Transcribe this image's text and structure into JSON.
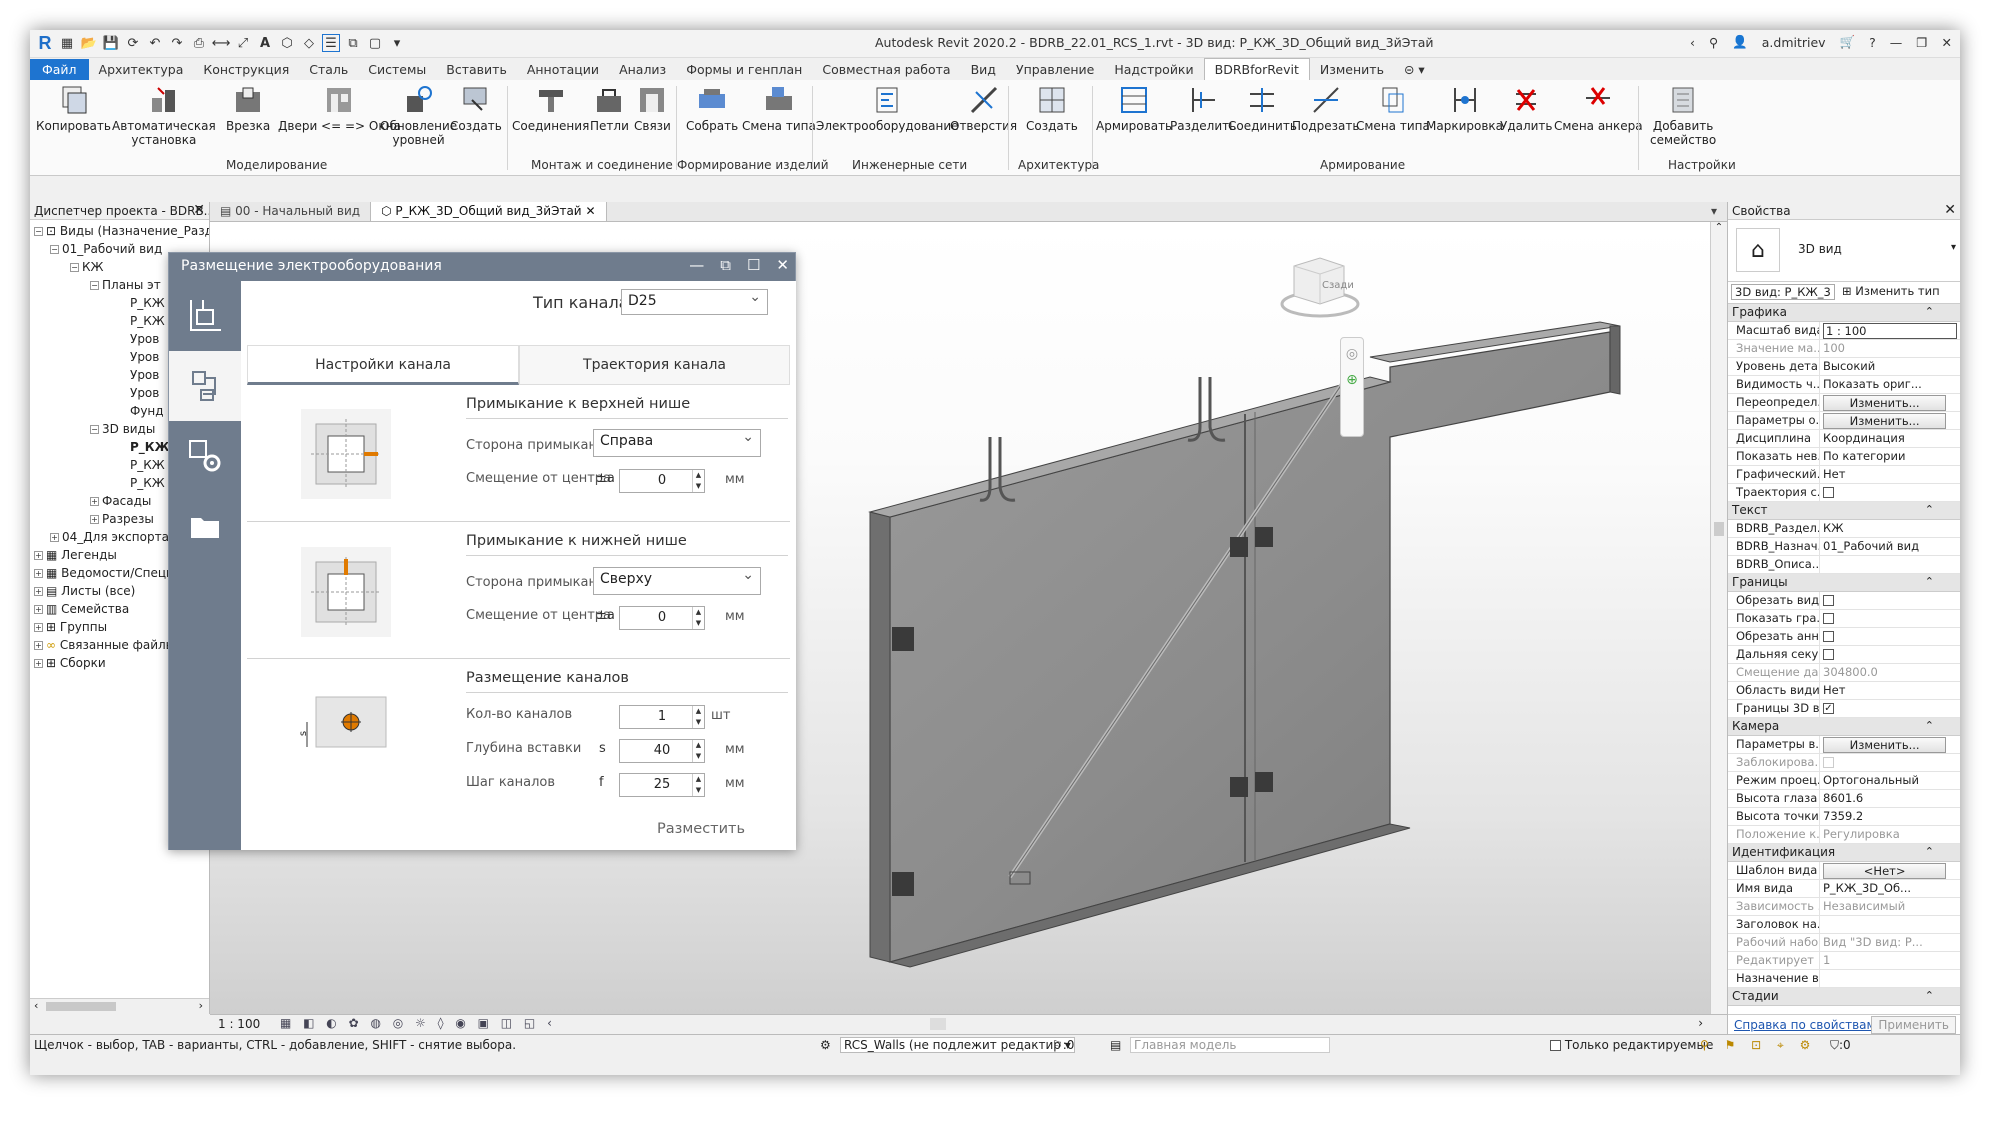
{
  "app": {
    "title": "Autodesk Revit 2020.2 - BDRB_22.01_RCS_1.rvt - 3D вид: Р_КЖ_3D_Общий вид_3йЭтай",
    "user": "a.dmitriev"
  },
  "ribbon_tabs": [
    "Файл",
    "Архитектура",
    "Конструкция",
    "Сталь",
    "Системы",
    "Вставить",
    "Аннотации",
    "Анализ",
    "Формы и генплан",
    "Совместная работа",
    "Вид",
    "Управление",
    "Надстройки",
    "BDRBforRevit",
    "Изменить"
  ],
  "ribbon": {
    "buttons": [
      {
        "label": "Копировать"
      },
      {
        "label": "Автоматическая\nустановка"
      },
      {
        "label": "Врезка"
      },
      {
        "label": "Двери <= => Окна"
      },
      {
        "label": "Обновление\nуровней"
      },
      {
        "label": "Создать"
      },
      {
        "label": "Соединения"
      },
      {
        "label": "Петли"
      },
      {
        "label": "Связи"
      },
      {
        "label": "Собрать"
      },
      {
        "label": "Смена типа"
      },
      {
        "label": "Электрооборудование"
      },
      {
        "label": "Отверстия"
      },
      {
        "label": "Создать"
      },
      {
        "label": "Армировать"
      },
      {
        "label": "Разделить"
      },
      {
        "label": "Соединить"
      },
      {
        "label": "Подрезать"
      },
      {
        "label": "Смена типа"
      },
      {
        "label": "Маркировка"
      },
      {
        "label": "Удалить"
      },
      {
        "label": "Смена анкера"
      },
      {
        "label": "Добавить\nсемейство"
      }
    ],
    "panels": [
      "Моделирование",
      "Монтаж и соединение",
      "Формирование изделий",
      "Инженерные сети",
      "Архитектура",
      "Армирование",
      "Настройки"
    ]
  },
  "browser": {
    "title": "Диспетчер проекта - BDRB...",
    "items": [
      {
        "text": "Виды (Назначение_Разд"
      },
      {
        "text": "01_Рабочий вид"
      },
      {
        "text": "КЖ"
      },
      {
        "text": "Планы эт"
      },
      {
        "text": "Р_КЖ"
      },
      {
        "text": "Р_КЖ"
      },
      {
        "text": "Уров"
      },
      {
        "text": "Уров"
      },
      {
        "text": "Уров"
      },
      {
        "text": "Уров"
      },
      {
        "text": "Фунд"
      },
      {
        "text": "3D виды"
      },
      {
        "text": "Р_КЖ"
      },
      {
        "text": "Р_КЖ"
      },
      {
        "text": "Р_КЖ"
      },
      {
        "text": "Фасады"
      },
      {
        "text": "Разрезы"
      },
      {
        "text": "04_Для экспорта"
      },
      {
        "text": "Легенды"
      },
      {
        "text": "Ведомости/Специ"
      },
      {
        "text": "Листы (все)"
      },
      {
        "text": "Семейства"
      },
      {
        "text": "Группы"
      },
      {
        "text": "Связанные файлы"
      },
      {
        "text": "Сборки"
      }
    ]
  },
  "view_tabs": [
    "00 - Начальный вид",
    "Р_КЖ_3D_Общий вид_3йЭтай"
  ],
  "viewbar": {
    "scale": "1 : 100"
  },
  "dialog": {
    "title": "Размещение электрооборудования",
    "channel_type_label": "Тип канала:",
    "channel_type_value": "D25",
    "tabs": [
      "Настройки канала",
      "Траектория канала"
    ],
    "top": {
      "header": "Примыкание к верхней нише",
      "side_label": "Сторона примыкания",
      "side_value": "Справа",
      "offset_label": "Смещение от центра",
      "offset_symbol": "±a",
      "offset_value": "0",
      "unit": "мм"
    },
    "bottom": {
      "header": "Примыкание к нижней нише",
      "side_label": "Сторона примыкания",
      "side_value": "Сверху",
      "offset_label": "Смещение от центра",
      "offset_symbol": "±a",
      "offset_value": "0",
      "unit": "мм"
    },
    "placement": {
      "header": "Размещение каналов",
      "count_label": "Кол-во каналов",
      "count_value": "1",
      "count_unit": "шт",
      "depth_label": "Глубина вставки",
      "depth_symbol": "s",
      "depth_value": "40",
      "depth_unit": "мм",
      "step_label": "Шаг каналов",
      "step_symbol": "f",
      "step_value": "25",
      "step_unit": "мм",
      "s_marker": "s"
    },
    "place_button": "Разместить"
  },
  "properties": {
    "title": "Свойства",
    "type_name": "3D вид",
    "selector": "3D вид: Р_КЖ_3",
    "edit_type": "Изменить тип",
    "groups": [
      {
        "name": "Графика",
        "rows": [
          {
            "k": "Масштаб вида",
            "v": "1 : 100",
            "kind": "input"
          },
          {
            "k": "Значение ма...",
            "v": "100",
            "kind": "gray"
          },
          {
            "k": "Уровень дета...",
            "v": "Высокий"
          },
          {
            "k": "Видимость ч...",
            "v": "Показать ориг..."
          },
          {
            "k": "Переопредел...",
            "v": "Изменить...",
            "kind": "button"
          },
          {
            "k": "Параметры о...",
            "v": "Изменить...",
            "kind": "button"
          },
          {
            "k": "Дисциплина",
            "v": "Координация"
          },
          {
            "k": "Показать нев...",
            "v": "По категории"
          },
          {
            "k": "Графический...",
            "v": "Нет"
          },
          {
            "k": "Траектория с...",
            "v": "",
            "kind": "check"
          }
        ]
      },
      {
        "name": "Текст",
        "rows": [
          {
            "k": "BDRB_Раздел...",
            "v": "КЖ"
          },
          {
            "k": "BDRB_Назнач...",
            "v": "01_Рабочий вид"
          },
          {
            "k": "BDRB_Описа...",
            "v": ""
          }
        ]
      },
      {
        "name": "Границы",
        "rows": [
          {
            "k": "Обрезать вид",
            "v": "",
            "kind": "check"
          },
          {
            "k": "Показать гра...",
            "v": "",
            "kind": "check"
          },
          {
            "k": "Обрезать анн...",
            "v": "",
            "kind": "check"
          },
          {
            "k": "Дальняя секу...",
            "v": "",
            "kind": "check"
          },
          {
            "k": "Смещение да...",
            "v": "304800.0",
            "kind": "gray"
          },
          {
            "k": "Область види...",
            "v": "Нет"
          },
          {
            "k": "Границы 3D в...",
            "v": "✓",
            "kind": "checked"
          }
        ]
      },
      {
        "name": "Камера",
        "rows": [
          {
            "k": "Параметры в...",
            "v": "Изменить...",
            "kind": "button"
          },
          {
            "k": "Заблокирова...",
            "v": "",
            "kind": "graycheck"
          },
          {
            "k": "Режим проец...",
            "v": "Ортогональный"
          },
          {
            "k": "Высота глаза ...",
            "v": "8601.6"
          },
          {
            "k": "Высота точки...",
            "v": "7359.2"
          },
          {
            "k": "Положение к...",
            "v": "Регулировка",
            "kind": "gray"
          }
        ]
      },
      {
        "name": "Идентификация",
        "rows": [
          {
            "k": "Шаблон вида",
            "v": "<Нет>",
            "kind": "button"
          },
          {
            "k": "Имя вида",
            "v": "Р_КЖ_3D_Об..."
          },
          {
            "k": "Зависимость ...",
            "v": "Независимый",
            "kind": "gray"
          },
          {
            "k": "Заголовок на...",
            "v": ""
          },
          {
            "k": "Рабочий набор",
            "v": "Вид \"3D вид: Р...",
            "kind": "gray"
          },
          {
            "k": "Редактирует",
            "v": "1",
            "kind": "gray"
          },
          {
            "k": "Назначение в...",
            "v": ""
          }
        ]
      },
      {
        "name": "Стадии",
        "rows": []
      }
    ],
    "help_link": "Справка по свойствам",
    "apply": "Применить"
  },
  "statusbar": {
    "hint": "Щелчок - выбор, TAB - варианты, CTRL - добавление, SHIFT - снятие выбора.",
    "workset": "RCS_Walls (не подлежит редактир",
    "counter": ":0",
    "model": "Главная модель",
    "editable_only": "Только редактируемые",
    "filter": ":0"
  },
  "viewcube": {
    "face": "Сзади"
  }
}
